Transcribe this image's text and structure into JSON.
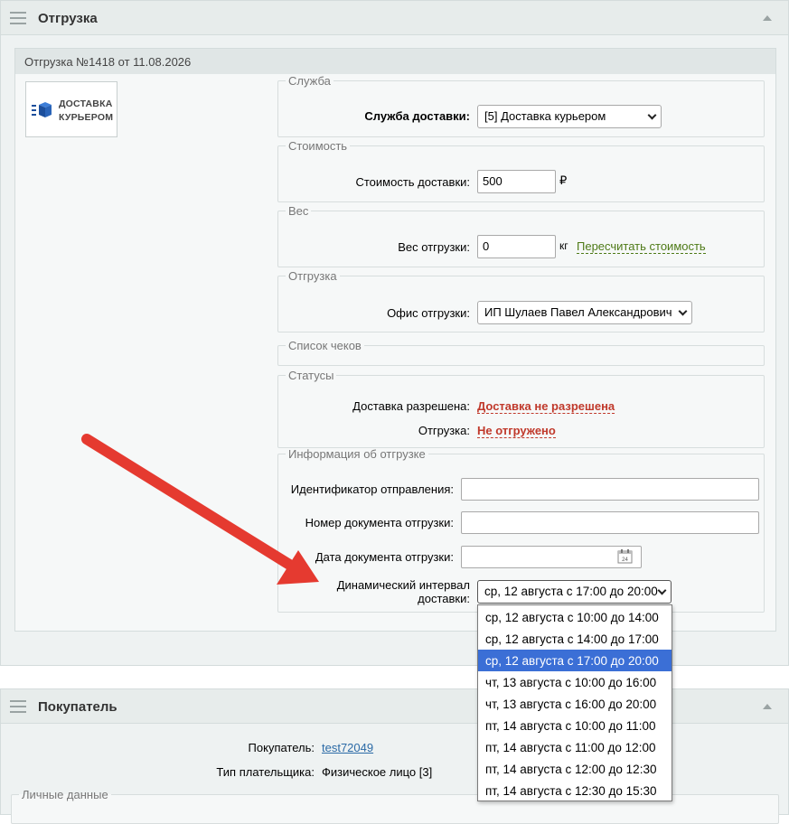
{
  "shipment_section": {
    "title": "Отгрузка",
    "subtitle": "Отгрузка №1418 от 11.08.2026",
    "logo_text_line1": "ДОСТАВКА",
    "logo_text_line2": "КУРЬЕРОМ"
  },
  "groups": {
    "service": {
      "legend": "Служба",
      "label": "Служба доставки:",
      "value": "[5] Доставка курьером"
    },
    "cost": {
      "legend": "Стоимость",
      "label": "Стоимость доставки:",
      "value": "500",
      "currency": "₽"
    },
    "weight": {
      "legend": "Вес",
      "label": "Вес отгрузки:",
      "value": "0",
      "unit": "кг",
      "recalc_link": "Пересчитать стоимость"
    },
    "shipment": {
      "legend": "Отгрузка",
      "label": "Офис отгрузки:",
      "value": "ИП Шулаев Павел Александрович"
    },
    "receipts": {
      "legend": "Список чеков"
    },
    "statuses": {
      "legend": "Статусы",
      "delivery_label": "Доставка разрешена:",
      "delivery_value": "Доставка не разрешена",
      "shipped_label": "Отгрузка:",
      "shipped_value": "Не отгружено"
    },
    "info": {
      "legend": "Информация об отгрузке",
      "tracking_label": "Идентификатор отправления:",
      "tracking_value": "",
      "doc_number_label": "Номер документа отгрузки:",
      "doc_number_value": "",
      "doc_date_label": "Дата документа отгрузки:",
      "doc_date_value": "",
      "calendar_day": "24",
      "interval_label_line1": "Динамический интервал",
      "interval_label_line2": "доставки:",
      "interval_selected": "ср, 12 августа с 17:00 до 20:00"
    }
  },
  "interval_options": [
    "ср, 12 августа с 10:00 до 14:00",
    "ср, 12 августа с 14:00 до 17:00",
    "ср, 12 августа с 17:00 до 20:00",
    "чт, 13 августа с 10:00 до 16:00",
    "чт, 13 августа с 16:00 до 20:00",
    "пт, 14 августа с 10:00 до 11:00",
    "пт, 14 августа с 11:00 до 12:00",
    "пт, 14 августа с 12:00 до 12:30",
    "пт, 14 августа с 12:30 до 15:30"
  ],
  "interval_active_index": 2,
  "buyer_section": {
    "title": "Покупатель",
    "buyer_label": "Покупатель:",
    "buyer_value": "test72049",
    "payer_type_label": "Тип плательщика:",
    "payer_type_value": "Физическое лицо [3]",
    "personal_data_legend": "Личные данные"
  },
  "colors": {
    "accent_selected": "#3b6fd6",
    "status_red": "#c0392b",
    "link_green": "#4e7a17",
    "link_blue": "#2b6aa6",
    "annotation_arrow": "#e53a30"
  }
}
